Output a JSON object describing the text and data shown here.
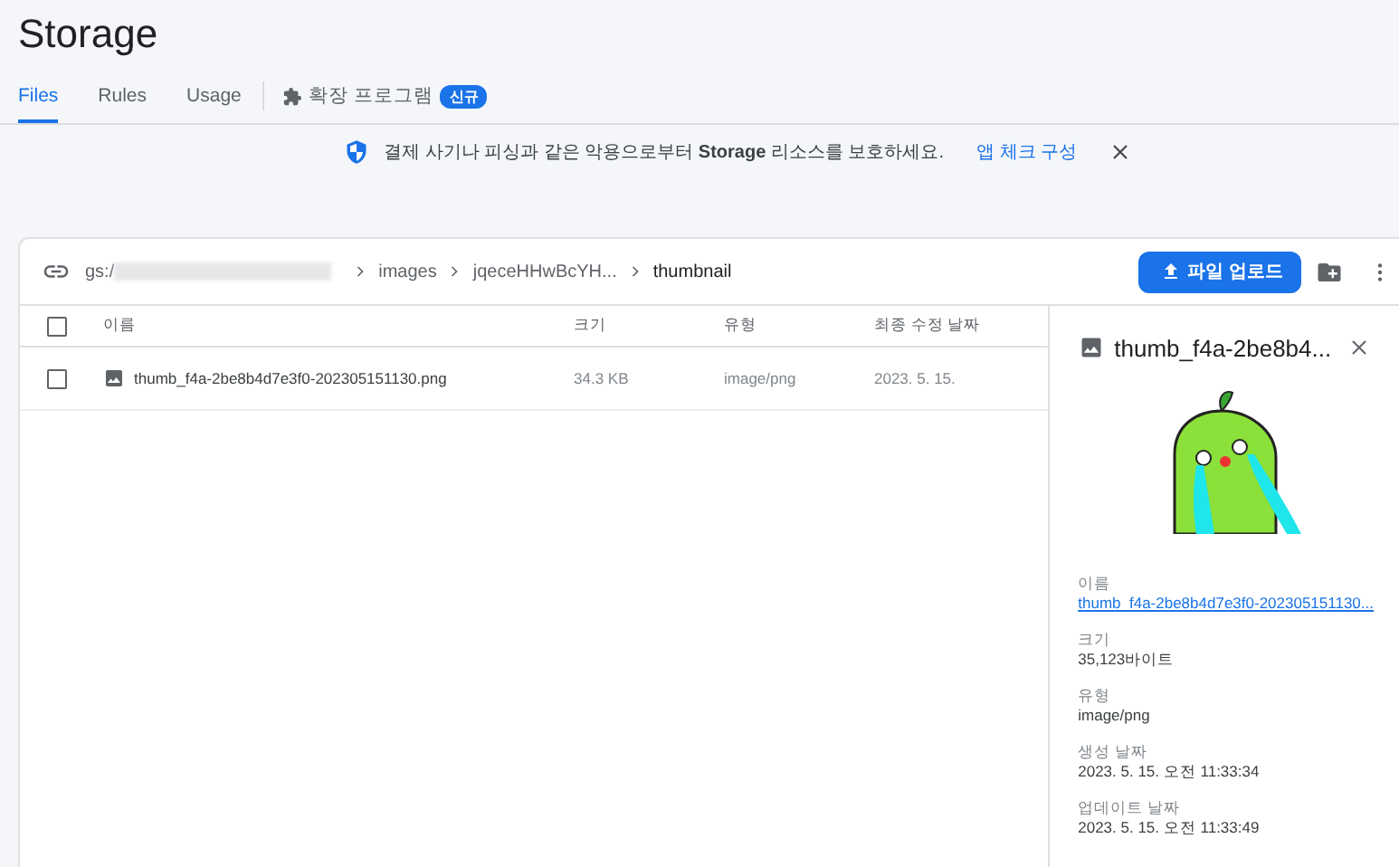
{
  "page_title": "Storage",
  "tabs": [
    {
      "label": "Files",
      "selected": true
    },
    {
      "label": "Rules",
      "selected": false
    },
    {
      "label": "Usage",
      "selected": false
    }
  ],
  "extension_tab": {
    "label": "확장 프로그램",
    "badge": "신규"
  },
  "banner": {
    "message": "결제 사기나 피싱과 같은 악용으로부터 **Storage** 리소스를 보호하세요.",
    "link": "앱 체크 구성"
  },
  "breadcrumb": {
    "bucket": "gs:/",
    "items": [
      "images",
      "jqeceHHwBcYH...",
      "thumbnail"
    ]
  },
  "upload_button": "파일 업로드",
  "table": {
    "select_all_checked": false,
    "columns": [
      "이름",
      "크기",
      "유형",
      "최종 수정 날짜"
    ],
    "rows": [
      {
        "name": "thumb_f4a-2be8b4d7e3f0-202305151130.png",
        "size": "34.3 KB",
        "type": "image/png",
        "modified": "2023. 5. 15.",
        "checked": false
      }
    ]
  },
  "details": {
    "title": "thumb_f4a-2be8b4...",
    "fields": [
      {
        "label": "이름",
        "value": "thumb_f4a-2be8b4d7e3f0-202305151130...",
        "kind": "link"
      },
      {
        "label": "크기",
        "value": "35,123바이트",
        "kind": "text"
      },
      {
        "label": "유형",
        "value": "image/png",
        "kind": "text"
      },
      {
        "label": "생성 날짜",
        "value": "2023. 5. 15. 오전 11:33:34",
        "kind": "text"
      },
      {
        "label": "업데이트 날짜",
        "value": "2023. 5. 15. 오전 11:33:49",
        "kind": "text"
      }
    ]
  }
}
